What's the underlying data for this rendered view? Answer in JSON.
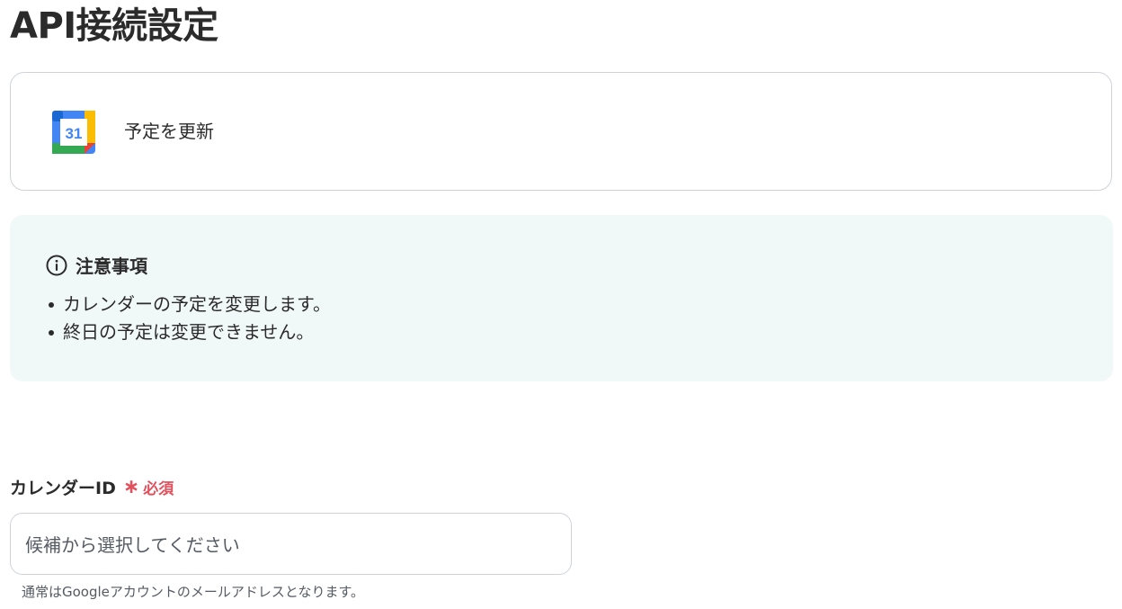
{
  "page": {
    "title": "API接続設定"
  },
  "action": {
    "icon": "google-calendar-icon",
    "icon_text": "31",
    "label": "予定を更新"
  },
  "notice": {
    "icon": "info-icon",
    "title": "注意事項",
    "items": [
      "カレンダーの予定を変更します。",
      "終日の予定は変更できません。"
    ]
  },
  "calendar_id_field": {
    "label": "カレンダーID",
    "required_label": "必須",
    "placeholder": "候補から選択してください",
    "value": "",
    "helper": "通常はGoogleアカウントのメールアドレスとなります。"
  },
  "colors": {
    "required": "#e2505e",
    "notice_bg": "#f1f9f8",
    "border": "#cfd3d8"
  }
}
